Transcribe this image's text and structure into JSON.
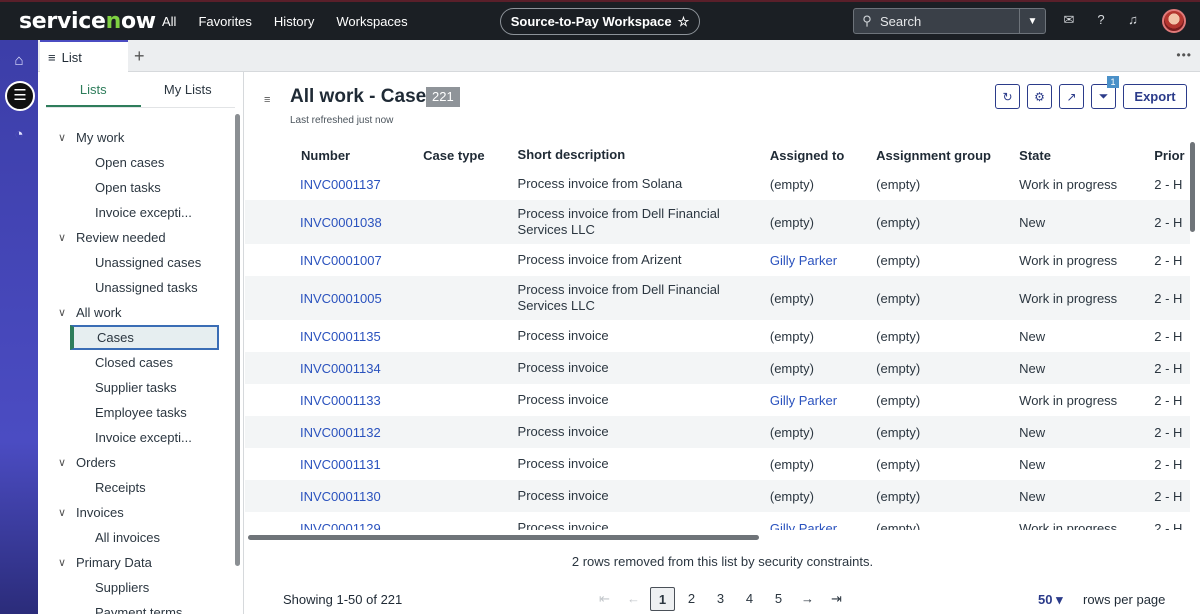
{
  "topbar": {
    "logo": "servicenow",
    "nav": [
      "All",
      "Favorites",
      "History",
      "Workspaces"
    ],
    "workspace": "Source-to-Pay Workspace",
    "search_placeholder": "Search"
  },
  "tabs": {
    "active": "List"
  },
  "sidebar": {
    "tabs": [
      "Lists",
      "My Lists"
    ],
    "tree": [
      {
        "type": "group",
        "label": "My work"
      },
      {
        "type": "leaf",
        "label": "Open cases"
      },
      {
        "type": "leaf",
        "label": "Open tasks"
      },
      {
        "type": "leaf",
        "label": "Invoice excepti..."
      },
      {
        "type": "group",
        "label": "Review needed"
      },
      {
        "type": "leaf",
        "label": "Unassigned cases"
      },
      {
        "type": "leaf",
        "label": "Unassigned tasks"
      },
      {
        "type": "group",
        "label": "All work"
      },
      {
        "type": "leaf",
        "label": "Cases",
        "selected": true
      },
      {
        "type": "leaf",
        "label": "Closed cases"
      },
      {
        "type": "leaf",
        "label": "Supplier tasks"
      },
      {
        "type": "leaf",
        "label": "Employee tasks"
      },
      {
        "type": "leaf",
        "label": "Invoice excepti..."
      },
      {
        "type": "group",
        "label": "Orders"
      },
      {
        "type": "leaf",
        "label": "Receipts"
      },
      {
        "type": "group",
        "label": "Invoices"
      },
      {
        "type": "leaf",
        "label": "All invoices"
      },
      {
        "type": "group",
        "label": "Primary Data"
      },
      {
        "type": "leaf",
        "label": "Suppliers"
      },
      {
        "type": "leaf",
        "label": "Payment terms"
      }
    ]
  },
  "main": {
    "title": "All work - Cases",
    "count": "221",
    "refreshed": "Last refreshed just now",
    "filter_badge": "1",
    "export_label": "Export",
    "columns": [
      "Number",
      "Case type",
      "Short description",
      "Assigned to",
      "Assignment group",
      "State",
      "Prior"
    ],
    "rows": [
      {
        "number": "INVC0001137",
        "case_type": "",
        "desc": "Process invoice from Solana",
        "assigned": "(empty)",
        "group": "(empty)",
        "state": "Work in progress",
        "priority": "2 - H"
      },
      {
        "number": "INVC0001038",
        "case_type": "",
        "desc": "Process invoice from Dell Financial Services LLC",
        "assigned": "(empty)",
        "group": "(empty)",
        "state": "New",
        "priority": "2 - H"
      },
      {
        "number": "INVC0001007",
        "case_type": "",
        "desc": "Process invoice from Arizent",
        "assigned": "Gilly Parker",
        "group": "(empty)",
        "state": "Work in progress",
        "priority": "2 - H"
      },
      {
        "number": "INVC0001005",
        "case_type": "",
        "desc": "Process invoice from Dell Financial Services LLC",
        "assigned": "(empty)",
        "group": "(empty)",
        "state": "Work in progress",
        "priority": "2 - H"
      },
      {
        "number": "INVC0001135",
        "case_type": "",
        "desc": "Process invoice",
        "assigned": "(empty)",
        "group": "(empty)",
        "state": "New",
        "priority": "2 - H"
      },
      {
        "number": "INVC0001134",
        "case_type": "",
        "desc": "Process invoice",
        "assigned": "(empty)",
        "group": "(empty)",
        "state": "New",
        "priority": "2 - H"
      },
      {
        "number": "INVC0001133",
        "case_type": "",
        "desc": "Process invoice",
        "assigned": "Gilly Parker",
        "group": "(empty)",
        "state": "Work in progress",
        "priority": "2 - H"
      },
      {
        "number": "INVC0001132",
        "case_type": "",
        "desc": "Process invoice",
        "assigned": "(empty)",
        "group": "(empty)",
        "state": "New",
        "priority": "2 - H"
      },
      {
        "number": "INVC0001131",
        "case_type": "",
        "desc": "Process invoice",
        "assigned": "(empty)",
        "group": "(empty)",
        "state": "New",
        "priority": "2 - H"
      },
      {
        "number": "INVC0001130",
        "case_type": "",
        "desc": "Process invoice",
        "assigned": "(empty)",
        "group": "(empty)",
        "state": "New",
        "priority": "2 - H"
      },
      {
        "number": "INVC0001129",
        "case_type": "",
        "desc": "Process invoice",
        "assigned": "Gilly Parker",
        "group": "(empty)",
        "state": "Work in progress",
        "priority": "2 - H"
      }
    ],
    "security_note": "2 rows removed from this list by security constraints.",
    "showing": "Showing 1-50 of 221",
    "pages": [
      "1",
      "2",
      "3",
      "4",
      "5"
    ],
    "current_page": "1",
    "per_page": "50",
    "per_page_label": "rows per page"
  }
}
